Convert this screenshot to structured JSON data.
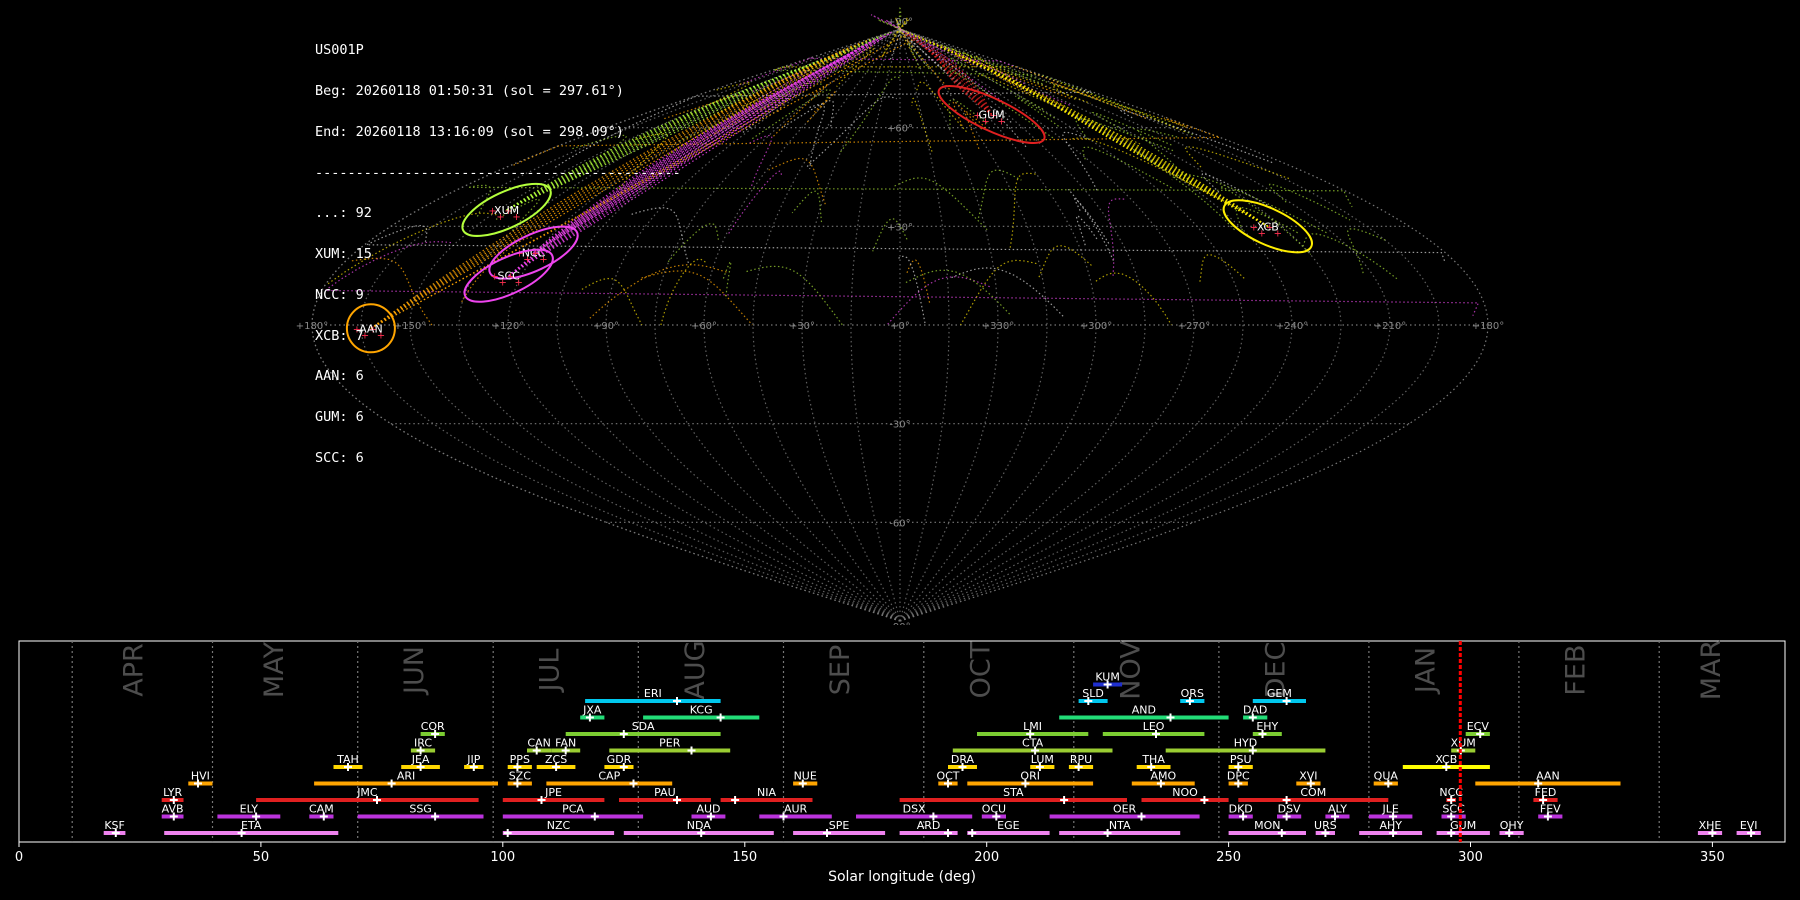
{
  "info": {
    "station": "US001P",
    "begin": "Beg: 20260118 01:50:31 (sol = 297.61°)",
    "end": "End: 20260118 13:16:09 (sol = 298.09°)",
    "separator": "---------------------------------------------",
    "counts": [
      "...: 92",
      "XUM: 15",
      "NCC: 9",
      "XCB: 7",
      "AAN: 6",
      "GUM: 6",
      "SCC: 6"
    ]
  },
  "sky_map": {
    "lon_labels": [
      "+180°",
      "+150°",
      "+120°",
      "+90°",
      "+60°",
      "+30°",
      "+0°",
      "+330°",
      "+300°",
      "+270°",
      "+240°",
      "+210°",
      "+180°"
    ],
    "lat_labels": [
      "+90°",
      "+60°",
      "+30°",
      "-30°",
      "-60°",
      "-90°"
    ],
    "colors": {
      "grid": "#777777",
      "sporadic_green": "#9acd32",
      "sporadic_orange": "#ffa500",
      "sporadic_magenta": "#dd44dd",
      "sporadic_yellow": "#e8d000"
    },
    "showers": [
      {
        "code": "XUM",
        "lon": 147,
        "lat": 35,
        "color": "#b4ff3c"
      },
      {
        "code": "NCC",
        "lon": 121,
        "lat": 22,
        "color": "#ee44ee"
      },
      {
        "code": "SCC",
        "lon": 124,
        "lat": 15,
        "color": "#ee44ee"
      },
      {
        "code": "AAN",
        "lon": 162,
        "lat": -1,
        "color": "#ffa500"
      },
      {
        "code": "GUM",
        "lon": 296,
        "lat": 64,
        "color": "#e02020"
      },
      {
        "code": "XCB",
        "lon": 230,
        "lat": 30,
        "color": "#ffee00"
      }
    ]
  },
  "chart_data": {
    "type": "timeline",
    "xlabel": "Solar longitude (deg)",
    "xlim": [
      0,
      365
    ],
    "x_ticks": [
      0,
      50,
      100,
      150,
      200,
      250,
      300,
      350
    ],
    "months": [
      {
        "name": "APR",
        "start": 11,
        "center": 24
      },
      {
        "name": "MAY",
        "start": 40,
        "center": 53
      },
      {
        "name": "JUN",
        "start": 70,
        "center": 82
      },
      {
        "name": "JUL",
        "start": 98,
        "center": 110
      },
      {
        "name": "AUG",
        "start": 128,
        "center": 140
      },
      {
        "name": "SEP",
        "start": 158,
        "center": 170
      },
      {
        "name": "OCT",
        "start": 187,
        "center": 199
      },
      {
        "name": "NOV",
        "start": 218,
        "center": 230
      },
      {
        "name": "DEC",
        "start": 248,
        "center": 260
      },
      {
        "name": "JAN",
        "start": 279,
        "center": 291
      },
      {
        "name": "FEB",
        "start": 310,
        "center": 322
      },
      {
        "name": "MAR",
        "start": 339,
        "center": 350
      }
    ],
    "current_sol": 297.9,
    "rows": 10,
    "showers": [
      {
        "code": "KSF",
        "row": 0,
        "start": 17.5,
        "end": 22,
        "peak": 20,
        "color": "#ee82ee"
      },
      {
        "code": "ETA",
        "row": 0,
        "start": 30,
        "end": 66,
        "peak": 46,
        "color": "#ee82ee"
      },
      {
        "code": "NZC",
        "row": 0,
        "start": 100,
        "end": 123,
        "peak": 101,
        "color": "#ee82ee"
      },
      {
        "code": "NDA",
        "row": 0,
        "start": 125,
        "end": 156,
        "peak": 141,
        "color": "#ee82ee"
      },
      {
        "code": "SPE",
        "row": 0,
        "start": 160,
        "end": 179,
        "peak": 167,
        "color": "#ee82ee"
      },
      {
        "code": "ARD",
        "row": 0,
        "start": 182,
        "end": 194,
        "peak": 192,
        "color": "#ee82ee"
      },
      {
        "code": "EGE",
        "row": 0,
        "start": 196,
        "end": 213,
        "peak": 197,
        "color": "#ee82ee"
      },
      {
        "code": "NTA",
        "row": 0,
        "start": 215,
        "end": 240,
        "peak": 225,
        "color": "#ee82ee"
      },
      {
        "code": "MON",
        "row": 0,
        "start": 250,
        "end": 266,
        "peak": 261,
        "color": "#ee82ee"
      },
      {
        "code": "URS",
        "row": 0,
        "start": 268,
        "end": 272,
        "peak": 270,
        "color": "#ee82ee"
      },
      {
        "code": "AHY",
        "row": 0,
        "start": 277,
        "end": 290,
        "peak": 284,
        "color": "#ee82ee"
      },
      {
        "code": "GUM",
        "row": 0,
        "start": 293,
        "end": 304,
        "peak": 296,
        "color": "#ee82ee"
      },
      {
        "code": "OHY",
        "row": 0,
        "start": 306,
        "end": 311,
        "peak": 308,
        "color": "#ee82ee"
      },
      {
        "code": "XHE",
        "row": 0,
        "start": 347,
        "end": 352,
        "peak": 350,
        "color": "#ee82ee"
      },
      {
        "code": "EVI",
        "row": 0,
        "start": 355,
        "end": 360,
        "peak": 358,
        "color": "#ee82ee"
      },
      {
        "code": "AVB",
        "row": 1,
        "start": 29.5,
        "end": 34,
        "peak": 32,
        "color": "#bb33dd"
      },
      {
        "code": "ELY",
        "row": 1,
        "start": 41,
        "end": 54,
        "peak": 49,
        "color": "#bb33dd"
      },
      {
        "code": "CAM",
        "row": 1,
        "start": 60,
        "end": 65,
        "peak": 63,
        "color": "#bb33dd"
      },
      {
        "code": "SSG",
        "row": 1,
        "start": 70,
        "end": 96,
        "peak": 86,
        "color": "#bb33dd"
      },
      {
        "code": "PCA",
        "row": 1,
        "start": 100,
        "end": 129,
        "peak": 119,
        "color": "#bb33dd"
      },
      {
        "code": "AUD",
        "row": 1,
        "start": 139,
        "end": 146,
        "peak": 143,
        "color": "#bb33dd"
      },
      {
        "code": "AUR",
        "row": 1,
        "start": 153,
        "end": 168,
        "peak": 158,
        "color": "#bb33dd"
      },
      {
        "code": "DSX",
        "row": 1,
        "start": 173,
        "end": 197,
        "peak": 189,
        "color": "#bb33dd"
      },
      {
        "code": "OCU",
        "row": 1,
        "start": 199,
        "end": 204,
        "peak": 202,
        "color": "#bb33dd"
      },
      {
        "code": "OER",
        "row": 1,
        "start": 213,
        "end": 244,
        "peak": 232,
        "color": "#bb33dd"
      },
      {
        "code": "DKD",
        "row": 1,
        "start": 250,
        "end": 255,
        "peak": 253,
        "color": "#bb33dd"
      },
      {
        "code": "DSV",
        "row": 1,
        "start": 260,
        "end": 265,
        "peak": 262,
        "color": "#bb33dd"
      },
      {
        "code": "ALY",
        "row": 1,
        "start": 270,
        "end": 275,
        "peak": 272,
        "color": "#bb33dd"
      },
      {
        "code": "JLE",
        "row": 1,
        "start": 279,
        "end": 288,
        "peak": 284,
        "color": "#bb33dd"
      },
      {
        "code": "SCC",
        "row": 1,
        "start": 294,
        "end": 299,
        "peak": 296,
        "color": "#bb33dd"
      },
      {
        "code": "FEV",
        "row": 1,
        "start": 314,
        "end": 319,
        "peak": 316,
        "color": "#bb33dd"
      },
      {
        "code": "LYR",
        "row": 2,
        "start": 29.5,
        "end": 34,
        "peak": 32,
        "color": "#e02020"
      },
      {
        "code": "JMC",
        "row": 2,
        "start": 49,
        "end": 95,
        "peak": 74,
        "color": "#e02020"
      },
      {
        "code": "JPE",
        "row": 2,
        "start": 100,
        "end": 121,
        "peak": 108,
        "color": "#e02020"
      },
      {
        "code": "PAU",
        "row": 2,
        "start": 124,
        "end": 143,
        "peak": 136,
        "color": "#e02020"
      },
      {
        "code": "NIA",
        "row": 2,
        "start": 145,
        "end": 164,
        "peak": 148,
        "color": "#e02020"
      },
      {
        "code": "STA",
        "row": 2,
        "start": 182,
        "end": 229,
        "peak": 216,
        "color": "#e02020"
      },
      {
        "code": "NOO",
        "row": 2,
        "start": 232,
        "end": 250,
        "peak": 245,
        "color": "#e02020"
      },
      {
        "code": "COM",
        "row": 2,
        "start": 252,
        "end": 283,
        "peak": 262,
        "color": "#e02020"
      },
      {
        "code": "NCC",
        "row": 2,
        "start": 295,
        "end": 297,
        "peak": 296,
        "color": "#e02020"
      },
      {
        "code": "FED",
        "row": 2,
        "start": 313,
        "end": 318,
        "peak": 315,
        "color": "#e02020"
      },
      {
        "code": "HVI",
        "row": 3,
        "start": 35,
        "end": 40,
        "peak": 37,
        "color": "#ffa500"
      },
      {
        "code": "ARI",
        "row": 3,
        "start": 61,
        "end": 99,
        "peak": 77,
        "color": "#ffa500"
      },
      {
        "code": "SZC",
        "row": 3,
        "start": 101,
        "end": 106,
        "peak": 103,
        "color": "#ffa500"
      },
      {
        "code": "CAP",
        "row": 3,
        "start": 109,
        "end": 135,
        "peak": 127,
        "color": "#ffa500"
      },
      {
        "code": "NUE",
        "row": 3,
        "start": 160,
        "end": 165,
        "peak": 162,
        "color": "#ffa500"
      },
      {
        "code": "OCT",
        "row": 3,
        "start": 190,
        "end": 194,
        "peak": 192,
        "color": "#ffa500"
      },
      {
        "code": "ORI",
        "row": 3,
        "start": 196,
        "end": 222,
        "peak": 208,
        "color": "#ffa500"
      },
      {
        "code": "AMO",
        "row": 3,
        "start": 230,
        "end": 243,
        "peak": 236,
        "color": "#ffa500"
      },
      {
        "code": "DPC",
        "row": 3,
        "start": 250,
        "end": 254,
        "peak": 252,
        "color": "#ffa500"
      },
      {
        "code": "XVI",
        "row": 3,
        "start": 264,
        "end": 269,
        "peak": 267,
        "color": "#ffa500"
      },
      {
        "code": "QUA",
        "row": 3,
        "start": 280,
        "end": 285,
        "peak": 283,
        "color": "#ffa500"
      },
      {
        "code": "AAN",
        "row": 3,
        "start": 301,
        "end": 331,
        "peak": 314,
        "color": "#ffa500"
      },
      {
        "code": "TAH",
        "row": 4,
        "start": 65,
        "end": 71,
        "peak": 68,
        "color": "#ffd700"
      },
      {
        "code": "JEA",
        "row": 4,
        "start": 79,
        "end": 87,
        "peak": 83,
        "color": "#ffd700"
      },
      {
        "code": "JIP",
        "row": 4,
        "start": 92,
        "end": 96,
        "peak": 94,
        "color": "#ffd700"
      },
      {
        "code": "PPS",
        "row": 4,
        "start": 101,
        "end": 106,
        "peak": 103,
        "color": "#ffd700"
      },
      {
        "code": "ZCS",
        "row": 4,
        "start": 107,
        "end": 115,
        "peak": 111,
        "color": "#ffd700"
      },
      {
        "code": "GDR",
        "row": 4,
        "start": 121,
        "end": 127,
        "peak": 125,
        "color": "#ffd700"
      },
      {
        "code": "DRA",
        "row": 4,
        "start": 192,
        "end": 198,
        "peak": 195,
        "color": "#ffd700"
      },
      {
        "code": "LUM",
        "row": 4,
        "start": 209,
        "end": 214,
        "peak": 211,
        "color": "#ffd700"
      },
      {
        "code": "RPU",
        "row": 4,
        "start": 217,
        "end": 222,
        "peak": 219,
        "color": "#ffd700"
      },
      {
        "code": "THA",
        "row": 4,
        "start": 231,
        "end": 238,
        "peak": 234,
        "color": "#ffd700"
      },
      {
        "code": "PSU",
        "row": 4,
        "start": 250,
        "end": 255,
        "peak": 252,
        "color": "#ffd700"
      },
      {
        "code": "XCB",
        "row": 4,
        "start": 286,
        "end": 304,
        "peak": 295,
        "color": "#ffff00"
      },
      {
        "code": "IRC",
        "row": 5,
        "start": 81,
        "end": 86,
        "peak": 83,
        "color": "#9acd32"
      },
      {
        "code": "CAN",
        "row": 5,
        "start": 105,
        "end": 110,
        "peak": 107,
        "color": "#9acd32"
      },
      {
        "code": "FAN",
        "row": 5,
        "start": 110,
        "end": 116,
        "peak": 113,
        "color": "#9acd32"
      },
      {
        "code": "PER",
        "row": 5,
        "start": 122,
        "end": 147,
        "peak": 139,
        "color": "#9acd32"
      },
      {
        "code": "CTA",
        "row": 5,
        "start": 193,
        "end": 226,
        "peak": 210,
        "color": "#9acd32"
      },
      {
        "code": "HYD",
        "row": 5,
        "start": 237,
        "end": 270,
        "peak": 255,
        "color": "#9acd32"
      },
      {
        "code": "XUM",
        "row": 5,
        "start": 296,
        "end": 301,
        "peak": 298,
        "color": "#9acd32"
      },
      {
        "code": "COR",
        "row": 6,
        "start": 83,
        "end": 88,
        "peak": 86,
        "color": "#7ccd32"
      },
      {
        "code": "SDA",
        "row": 6,
        "start": 113,
        "end": 145,
        "peak": 125,
        "color": "#7ccd32"
      },
      {
        "code": "LMI",
        "row": 6,
        "start": 198,
        "end": 221,
        "peak": 209,
        "color": "#7ccd32"
      },
      {
        "code": "LEO",
        "row": 6,
        "start": 224,
        "end": 245,
        "peak": 235,
        "color": "#7ccd32"
      },
      {
        "code": "EHY",
        "row": 6,
        "start": 255,
        "end": 261,
        "peak": 257,
        "color": "#7ccd32"
      },
      {
        "code": "ECV",
        "row": 6,
        "start": 299,
        "end": 304,
        "peak": 302,
        "color": "#7ccd32"
      },
      {
        "code": "JXA",
        "row": 7,
        "start": 116,
        "end": 121,
        "peak": 118,
        "color": "#22dd77"
      },
      {
        "code": "KCG",
        "row": 7,
        "start": 129,
        "end": 153,
        "peak": 145,
        "color": "#22dd77"
      },
      {
        "code": "AND",
        "row": 7,
        "start": 215,
        "end": 250,
        "peak": 238,
        "color": "#22dd77"
      },
      {
        "code": "DAD",
        "row": 7,
        "start": 253,
        "end": 258,
        "peak": 255,
        "color": "#22dd77"
      },
      {
        "code": "ERI",
        "row": 8,
        "start": 117,
        "end": 145,
        "peak": 136,
        "color": "#00c8ee"
      },
      {
        "code": "SLD",
        "row": 8,
        "start": 219,
        "end": 225,
        "peak": 221,
        "color": "#00c8ee"
      },
      {
        "code": "ORS",
        "row": 8,
        "start": 240,
        "end": 245,
        "peak": 242,
        "color": "#00c8ee"
      },
      {
        "code": "GEM",
        "row": 8,
        "start": 255,
        "end": 266,
        "peak": 262,
        "color": "#00c8ee"
      },
      {
        "code": "KUM",
        "row": 9,
        "start": 222,
        "end": 228,
        "peak": 225,
        "color": "#1f2fd0"
      }
    ]
  }
}
